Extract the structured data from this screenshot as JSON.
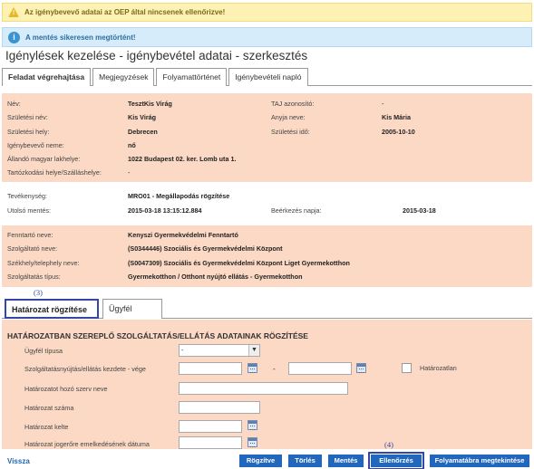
{
  "banners": {
    "warning": "Az igénybevevő adatai az OEP által nincsenek ellenőrizve!",
    "info": "A mentés sikeresen megtörtént!"
  },
  "page_title": "Igénylések kezelése - igénybevétel adatai - szerkesztés",
  "top_tabs": [
    "Feladat végrehajtása",
    "Megjegyzések",
    "Folyamattörténet",
    "Igénybevételi napló"
  ],
  "person": {
    "nev_label": "Név:",
    "nev": "TesztKis Virág",
    "taj_label": "TAJ azonosító:",
    "taj": "-",
    "szuletesi_nev_label": "Születési név:",
    "szuletesi_nev": "Kis Virág",
    "anyja_neve_label": "Anyja neve:",
    "anyja_neve": "Kis Mária",
    "szuletesi_hely_label": "Születési hely:",
    "szuletesi_hely": "Debrecen",
    "szuletesi_ido_label": "Születési idő:",
    "szuletesi_ido": "2005-10-10",
    "nem_label": "Igénybevevő neme:",
    "nem": "nő",
    "lakhely_label": "Állandó magyar lakhelye:",
    "lakhely": "1022 Budapest 02. ker. Lomb uta 1.",
    "tartozkodasi_label": "Tartózkodási helye/Szálláshelye:",
    "tartozkodasi": "-"
  },
  "activity": {
    "tevekenyseg_label": "Tevékenység:",
    "tevekenyseg": "MRO01 - Megállapodás rögzítése",
    "utolso_mentes_label": "Utolsó mentés:",
    "utolso_mentes": "2015-03-18 13:15:12.884",
    "beerkezes_label": "Beérkezés napja:",
    "beerkezes": "2015-03-18"
  },
  "provider": {
    "fenntarto_label": "Fenntartó neve:",
    "fenntarto": "Kenyszi Gyermekvédelmi Fenntartó",
    "szolgaltato_label": "Szolgáltató neve:",
    "szolgaltato": "(S0344446) Szociális és Gyermekvédelmi Központ",
    "szekhely_label": "Székhely/telephely neve:",
    "szekhely": "(S0047309) Szociális és Gyermekvédelmi Központ Liget Gyermekotthon",
    "tipus_label": "Szolgáltatás típus:",
    "tipus": "Gyermekotthon / Otthont nyújtó ellátás - Gyermekotthon"
  },
  "step_markers": {
    "three": "(3)",
    "four": "(4)"
  },
  "sub_tabs": [
    "Határozat rögzítése",
    "Ügyfél adatai"
  ],
  "form": {
    "section_title": "HATÁROZATBAN SZEREPLŐ SZOLGÁLTATÁS/ELLÁTÁS ADATAINAK RÖGZÍTÉSE",
    "ugyfel_tipusa_label": "Ügyfél típusa",
    "ugyfel_tipusa_value": "-",
    "kezdete_label": "Szolgáltatásnyújtás/ellátás kezdete - vége",
    "dash": "-",
    "hatarozatlan_label": "Határozatlan",
    "hozo_szerv_label": "Határozatot hozó szerv neve",
    "szama_label": "Határozat száma",
    "kelte_label": "Határozat kelte",
    "jogerore_label": "Határozat jogerőre emelkedésének dátuma"
  },
  "footer": {
    "back": "Vissza",
    "buttons": [
      "Rögzítve",
      "Törlés",
      "Mentés",
      "Ellenőrzés",
      "Folyamatábra megtekintése"
    ]
  },
  "colors": {
    "panel": "#fbd9c4",
    "button": "#2167be",
    "step_marker": "#3546a8"
  }
}
